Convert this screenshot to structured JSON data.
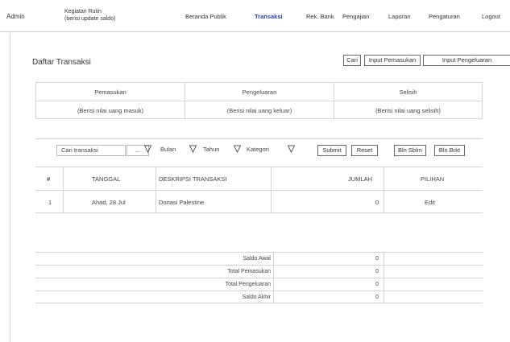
{
  "header": {
    "brand": "Admin",
    "subtitle_line1": "Kegiatan Rutin",
    "subtitle_line2": "(berisi update saldo)",
    "nav": [
      "Beranda Publik",
      "Transaksi",
      "Rek. Bank",
      "Pengajian",
      "Laporan",
      "Pengaturan",
      "Logout"
    ],
    "active_nav": "Transaksi"
  },
  "page": {
    "title": "Daftar Transaksi",
    "buttons": {
      "search": "Cari",
      "add_income": "Input Pemasukan",
      "add_expense": "Input Pengeluaran"
    }
  },
  "summary": {
    "headers": [
      "Pemasukan",
      "Pengeluaran",
      "Selisih"
    ],
    "values": [
      "(Berisi nilai uang masuk)",
      "(Berisi nilai uang keluar)",
      "(Berisi nilai uang selisih)"
    ]
  },
  "filters": {
    "search_placeholder": "Cari transaksi",
    "dropdown_value": "...",
    "month_label": "Bulan",
    "year_label": "Tahun",
    "category_label": "Kategori",
    "buttons": [
      "Submit",
      "Reset",
      "Bln Sblm",
      "Bln Brkt"
    ]
  },
  "table": {
    "columns": [
      "#",
      "TANGGAL",
      "DESKRIPSI TRANSAKSI",
      "JUMLAH",
      "PILIHAN"
    ],
    "rows": [
      {
        "no": "1",
        "date": "Ahad, 28 Jul",
        "desc": "Donasi Palestine",
        "amount": "0",
        "action": "Edit"
      }
    ]
  },
  "footer": {
    "rows": [
      {
        "label": "Saldo Awal",
        "value": "0"
      },
      {
        "label": "Total Pemasukan",
        "value": "0"
      },
      {
        "label": "Total Pengeluaran",
        "value": "0"
      },
      {
        "label": "Saldo Akhir",
        "value": "0"
      }
    ]
  },
  "colors": {
    "active_nav": "#2a3fa8",
    "border": "#d5d5d5"
  }
}
